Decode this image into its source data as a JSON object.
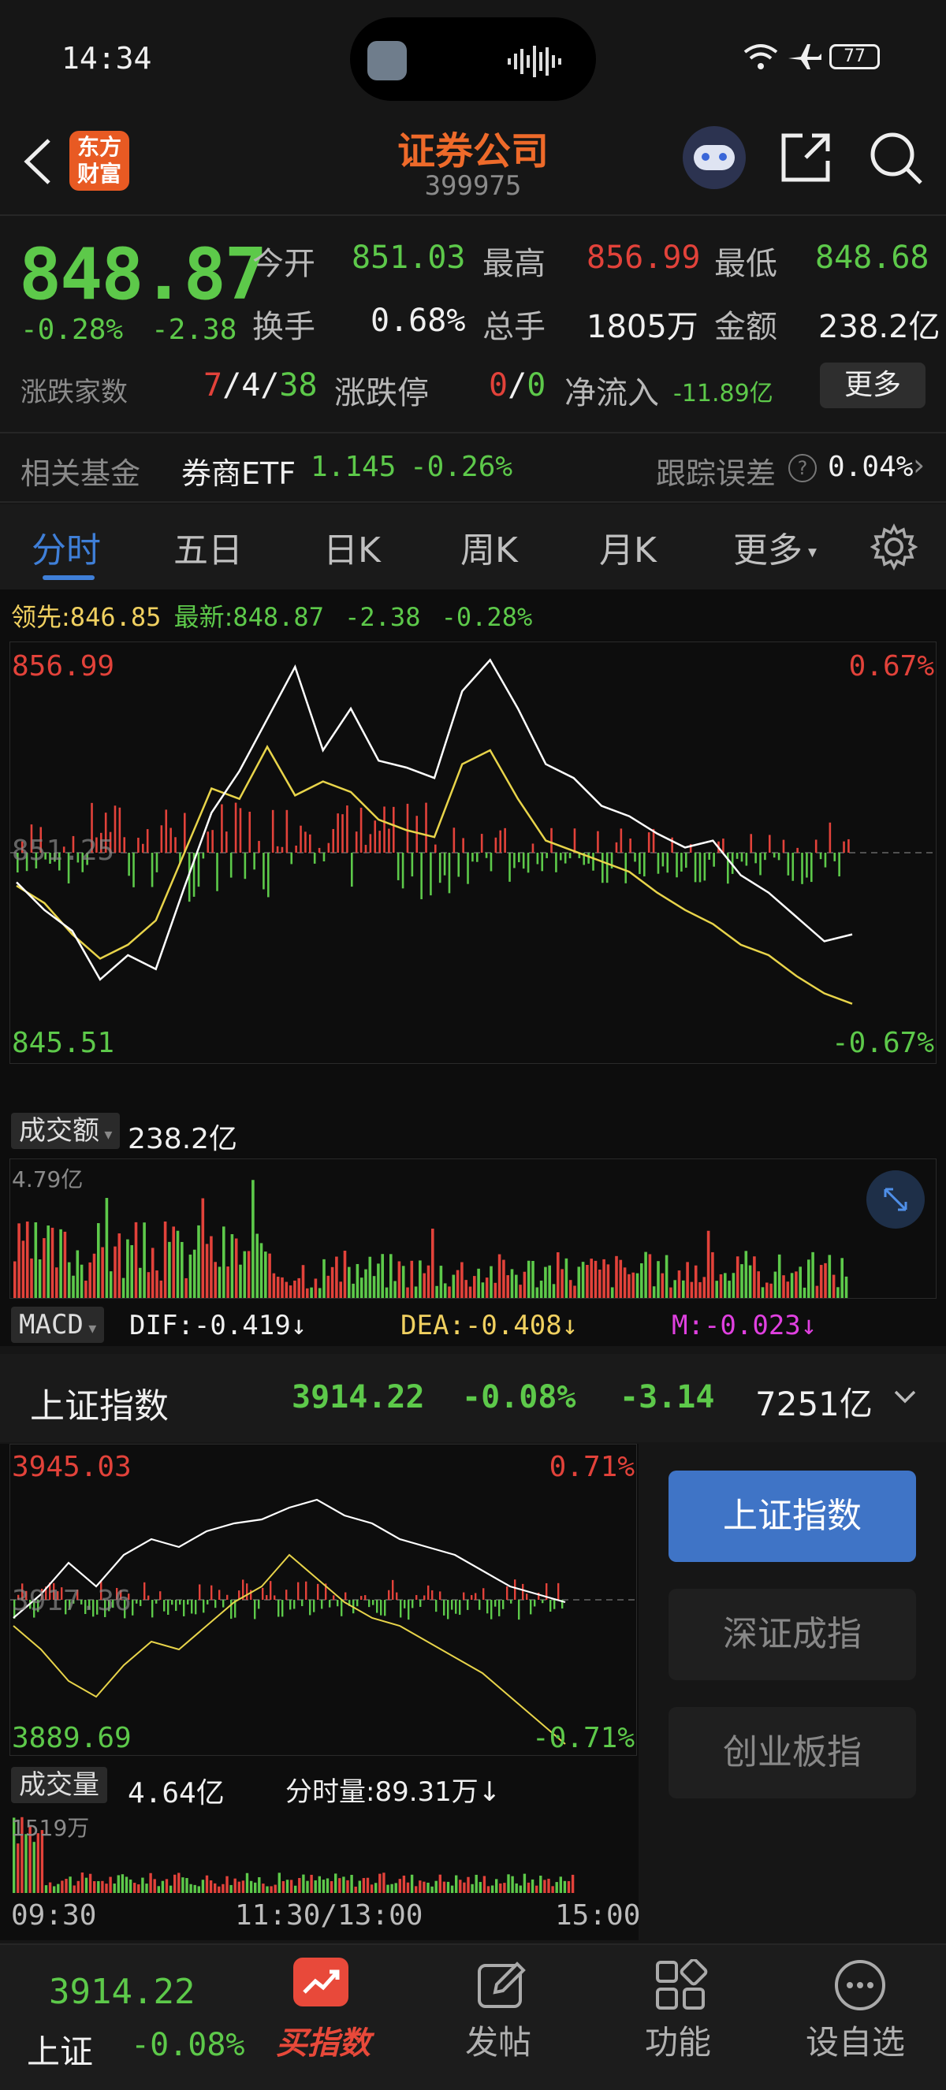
{
  "status_bar": {
    "time": "14:34",
    "battery": "77"
  },
  "header": {
    "title": "证券公司",
    "code": "399975",
    "logo_text_1": "东方",
    "logo_text_2": "财富"
  },
  "quote": {
    "price": "848.87",
    "change_pct": "-0.28%",
    "change": "-2.38",
    "open_label": "今开",
    "open": "851.03",
    "high_label": "最高",
    "high": "856.99",
    "low_label": "最低",
    "low": "848.68",
    "turnover_label": "换手",
    "turnover": "0.68%",
    "volume_label": "总手",
    "volume": "1805万",
    "amount_label": "金额",
    "amount": "238.2亿",
    "updown_label": "涨跌家数",
    "up": "7",
    "flat": "4",
    "down": "38",
    "sep": "/",
    "limit_label": "涨跌停",
    "limit_up": "0",
    "limit_down": "0",
    "netflow_label": "净流入",
    "netflow": "-11.89亿",
    "more": "更多"
  },
  "fund": {
    "label": "相关基金",
    "name": "券商ETF",
    "price": "1.145",
    "change": "-0.26%",
    "track_label": "跟踪误差",
    "track_value": "0.04%"
  },
  "tabs": [
    "分时",
    "五日",
    "日K",
    "周K",
    "月K",
    "更多"
  ],
  "chart": {
    "lead_label": "领先:",
    "lead_value": "846.85",
    "latest_label": "最新:",
    "latest_value": "848.87",
    "latest_change": "-2.38",
    "latest_pct": "-0.28%",
    "y_max": "856.99",
    "y_mid": "851.25",
    "y_min": "845.51",
    "pct_max": "0.67%",
    "pct_min": "-0.67%",
    "amount_selector": "成交额",
    "amount_total": "238.2亿",
    "amount_max": "4.79亿",
    "macd_selector": "MACD",
    "dif": "DIF:-0.419↓",
    "dea": "DEA:-0.408↓",
    "m": "M:-0.023↓",
    "colors": {
      "price_line": "#ffffff",
      "avg_line": "#e8d44a",
      "up": "#e2423a",
      "down": "#5dc94a"
    }
  },
  "chart_data": {
    "type": "line",
    "ylim": [
      845.51,
      856.99
    ],
    "series": [
      {
        "values": [
          850.4,
          849.6,
          849.0,
          847.6,
          848.3,
          847.9,
          850.2,
          852.4,
          853.6,
          855.1,
          856.6,
          854.2,
          855.4,
          853.9,
          853.7,
          853.4,
          855.9,
          856.8,
          855.4,
          853.8,
          853.4,
          852.6,
          852.3,
          851.8,
          851.4,
          851.6,
          850.6,
          850.1,
          849.4,
          848.7,
          848.9
        ]
      },
      {
        "values": [
          850.3,
          849.8,
          848.9,
          848.2,
          848.6,
          849.3,
          851.2,
          853.1,
          852.8,
          854.3,
          852.9,
          853.3,
          853.0,
          852.2,
          851.9,
          851.7,
          853.8,
          854.2,
          852.8,
          851.6,
          851.3,
          851.0,
          850.7,
          850.1,
          849.6,
          849.2,
          848.6,
          848.3,
          847.7,
          847.2,
          846.9
        ]
      }
    ]
  },
  "index_bar": {
    "name": "上证指数",
    "price": "3914.22",
    "pct": "-0.08%",
    "change": "-3.14",
    "amount": "7251亿"
  },
  "chart2": {
    "y_max": "3945.03",
    "y_mid": "3917.36",
    "y_min": "3889.69",
    "pct_max": "0.71%",
    "pct_min": "-0.71%",
    "vol_selector": "成交量",
    "vol_total": "4.64亿",
    "minute_vol": "分时量:89.31万↓",
    "vol_max": "1519万",
    "time_start": "09:30",
    "time_mid": "11:30/13:00",
    "time_end": "15:00"
  },
  "index_buttons": [
    "上证指数",
    "深证成指",
    "创业板指"
  ],
  "bottom_nav": {
    "idx_price": "3914.22",
    "idx_name": "上证",
    "idx_pct": "-0.08%",
    "items": [
      "买指数",
      "发帖",
      "功能",
      "设自选"
    ]
  }
}
